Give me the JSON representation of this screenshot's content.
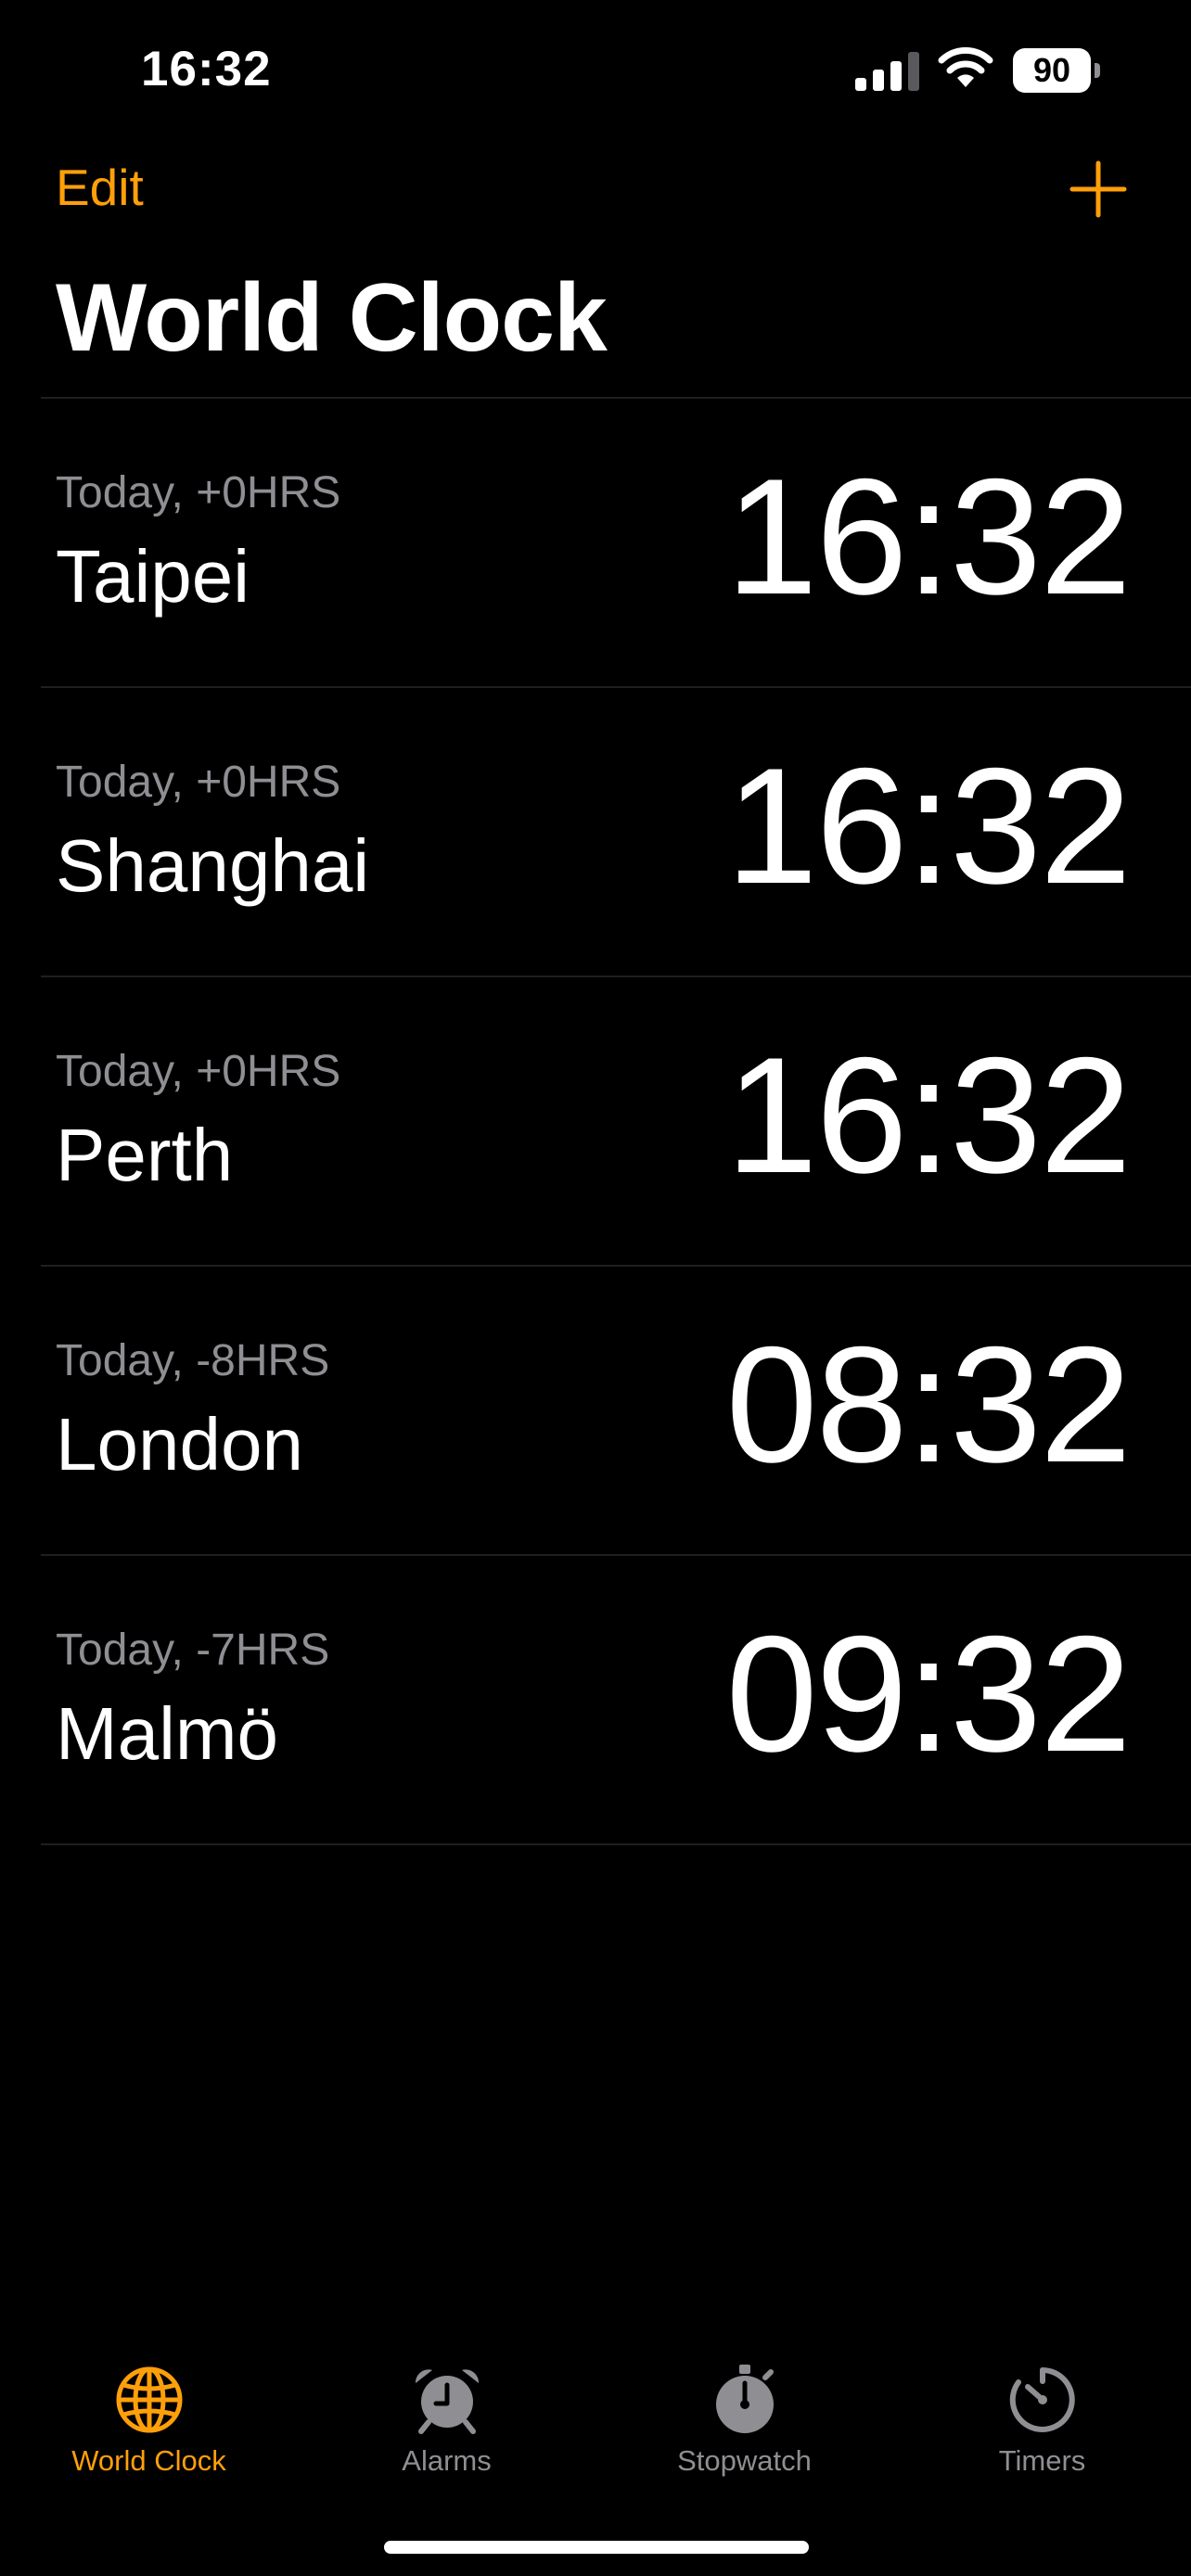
{
  "status_bar": {
    "time": "16:32",
    "battery_level": "90",
    "signal_bars_filled": 3,
    "signal_bars_total": 4
  },
  "nav": {
    "edit_label": "Edit",
    "add_icon": "plus-icon",
    "title": "World Clock"
  },
  "clocks": [
    {
      "offset": "Today, +0HRS",
      "city": "Taipei",
      "time": "16:32"
    },
    {
      "offset": "Today, +0HRS",
      "city": "Shanghai",
      "time": "16:32"
    },
    {
      "offset": "Today, +0HRS",
      "city": "Perth",
      "time": "16:32"
    },
    {
      "offset": "Today, -8HRS",
      "city": "London",
      "time": "08:32"
    },
    {
      "offset": "Today, -7HRS",
      "city": "Malmö",
      "time": "09:32"
    }
  ],
  "tabs": [
    {
      "label": "World Clock",
      "icon": "globe-icon",
      "active": true
    },
    {
      "label": "Alarms",
      "icon": "alarm-clock-icon",
      "active": false
    },
    {
      "label": "Stopwatch",
      "icon": "stopwatch-icon",
      "active": false
    },
    {
      "label": "Timers",
      "icon": "timer-icon",
      "active": false
    }
  ],
  "colors": {
    "accent": "#ff9f0a",
    "background": "#000000",
    "secondary_text": "#8e8e93",
    "inactive_tab": "#8e8e93",
    "separator": "#1f1f21"
  }
}
